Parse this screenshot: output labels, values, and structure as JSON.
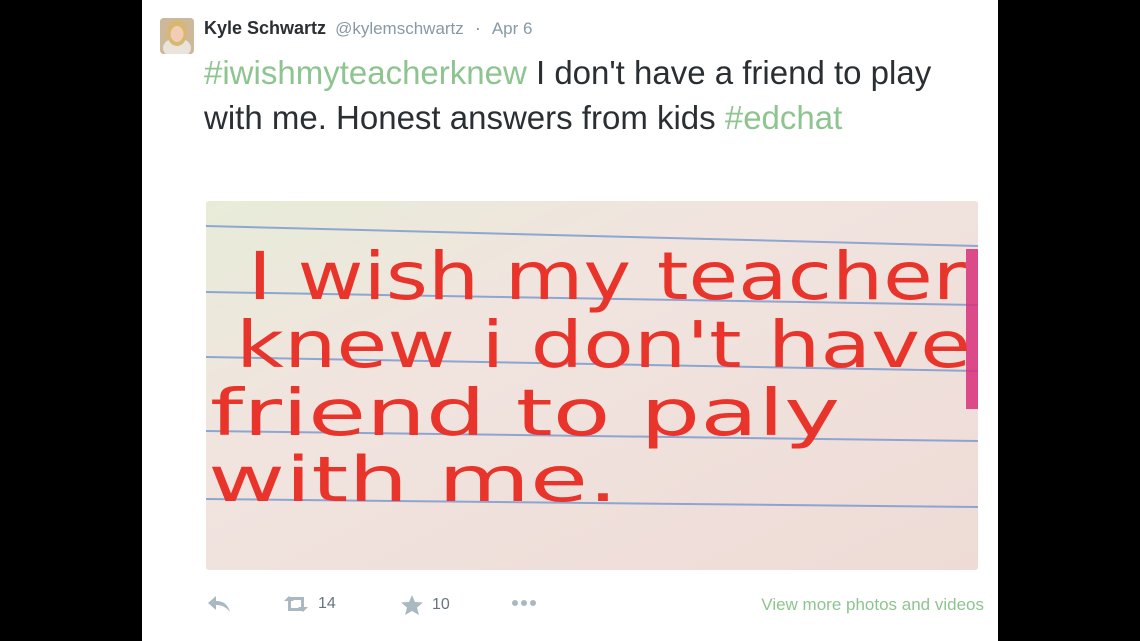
{
  "tweet": {
    "author_name": "Kyle Schwartz",
    "author_handle": "@kylemschwartz",
    "separator": "·",
    "date": "Apr 6",
    "text_parts": {
      "hashtag1": "#iwishmyteacherknew",
      "body": " I don't have a friend to play with me. Honest answers from kids ",
      "hashtag2": "#edchat"
    },
    "photo": {
      "handwriting": {
        "line1": "I wish my teacher",
        "line2": "knew i don't have",
        "line3": "friend to paly",
        "line4": "with me."
      }
    }
  },
  "actions": {
    "reply_icon": "reply-arrow-icon",
    "retweet_icon": "retweet-icon",
    "retweet_count": "14",
    "favorite_icon": "star-icon",
    "favorite_count": "10",
    "more_icon": "ellipsis-icon",
    "more_media_link": "View more photos and videos"
  },
  "colors": {
    "hashtag": "#8ec48f",
    "text": "#292f33",
    "meta": "#8899a6",
    "ink": "#e8342a",
    "paper": "#efe1dd",
    "rule": "#7c9bd0"
  }
}
